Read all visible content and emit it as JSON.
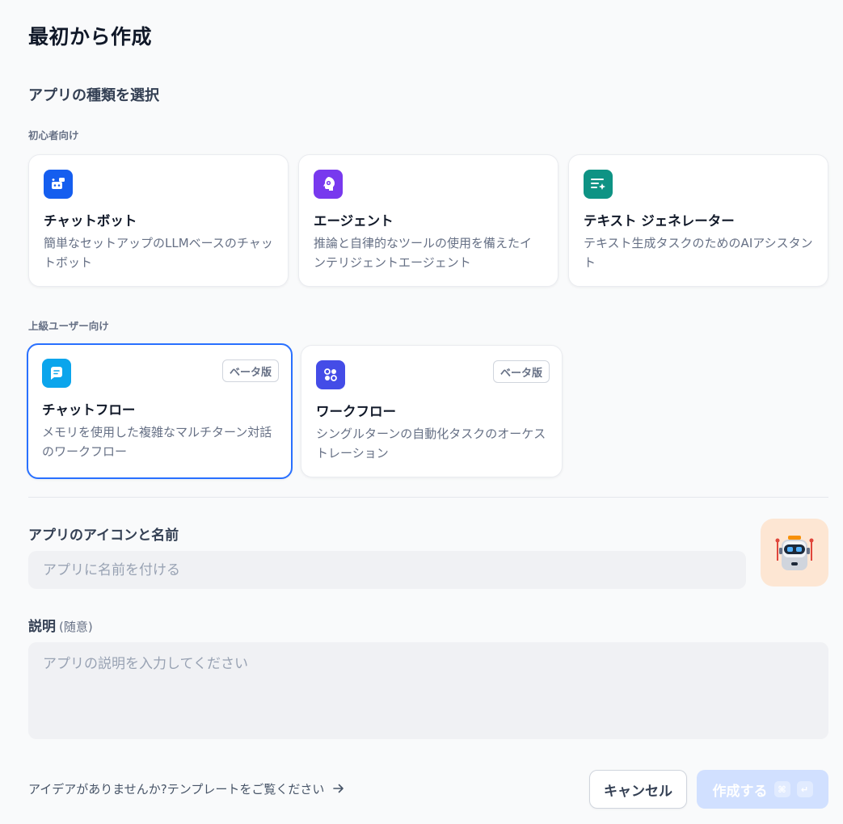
{
  "page": {
    "title": "最初から作成"
  },
  "app_type": {
    "section_title": "アプリの種類を選択",
    "beginner_label": "初心者向け",
    "advanced_label": "上級ユーザー向け",
    "beginner_cards": [
      {
        "icon": "chatbot-icon",
        "color": "#155eef",
        "title": "チャットボット",
        "description": "簡単なセットアップのLLMベースのチャットボット"
      },
      {
        "icon": "agent-icon",
        "color": "#7839ee",
        "title": "エージェント",
        "description": "推論と自律的なツールの使用を備えたインテリジェントエージェント"
      },
      {
        "icon": "text-generator-icon",
        "color": "#0e9384",
        "title": "テキスト ジェネレーター",
        "description": "テキスト生成タスクのためのAIアシスタント"
      }
    ],
    "advanced_cards": [
      {
        "icon": "chatflow-icon",
        "color": "#0ba5ec",
        "title": "チャットフロー",
        "description": "メモリを使用した複雑なマルチターン対話のワークフロー",
        "badge": "ベータ版",
        "selected": true
      },
      {
        "icon": "workflow-icon",
        "color": "#444ce7",
        "title": "ワークフロー",
        "description": "シングルターンの自動化タスクのオーケストレーション",
        "badge": "ベータ版",
        "selected": false
      }
    ]
  },
  "form": {
    "name_label": "アプリのアイコンと名前",
    "name_placeholder": "アプリに名前を付ける",
    "name_value": "",
    "app_icon": "robot-icon",
    "description_label": "説明",
    "description_optional": "(随意)",
    "description_placeholder": "アプリの説明を入力してください"
  },
  "footer": {
    "template_link": "アイデアがありませんか?テンプレートをご覧ください",
    "cancel_label": "キャンセル",
    "create_label": "作成する",
    "shortcut_cmd": "⌘",
    "shortcut_enter": "↵"
  }
}
